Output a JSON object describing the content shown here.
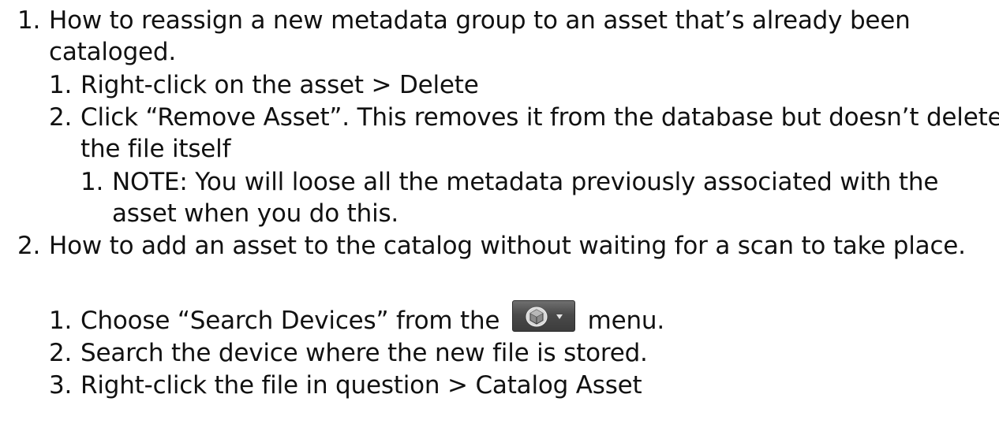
{
  "items": [
    {
      "number": "1.",
      "line1": "How to reassign a new metadata group to an asset that’s already been",
      "line2": "cataloged.",
      "subitems": [
        {
          "number": "1.",
          "text": "Right-click on the asset > Delete"
        },
        {
          "number": "2.",
          "line1": "Click “Remove Asset”. This removes it from the database but doesn’t delete",
          "line2": "the file itself",
          "subitems": [
            {
              "number": "1.",
              "line1": "NOTE: You will loose all the metadata previously associated with the",
              "line2": "asset when you do this."
            }
          ]
        }
      ]
    },
    {
      "number": "2.",
      "text": "How to add an asset to the catalog without waiting for a scan to take place.",
      "subitems": [
        {
          "number": "1.",
          "before_icon": "Choose “Search Devices” from the",
          "icon": "devices-dropdown-icon",
          "after_icon": "menu."
        },
        {
          "number": "2.",
          "text": "Search the device where the new file is stored."
        },
        {
          "number": "3.",
          "text": "Right-click the file in question > Catalog Asset"
        }
      ]
    }
  ]
}
